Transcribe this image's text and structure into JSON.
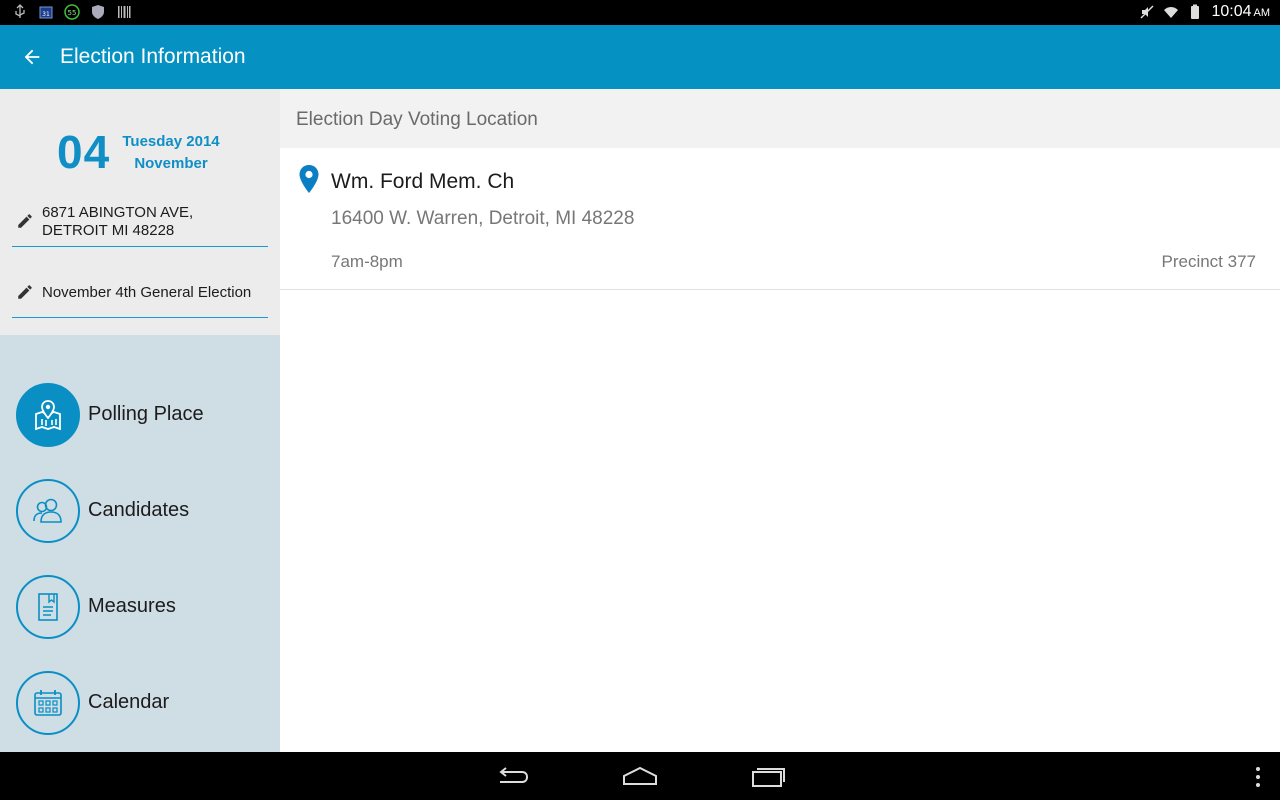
{
  "status_bar": {
    "time": "10:04",
    "ampm": "AM",
    "notification_icons": [
      "usb-icon",
      "calendar-icon",
      "badge-55-icon",
      "shield-icon",
      "barcode-icon"
    ],
    "badge_text": "55",
    "status_icons": [
      "mute-icon",
      "wifi-icon",
      "battery-icon"
    ]
  },
  "app_bar": {
    "title": "Election Information",
    "back_icon": "arrow-left-icon"
  },
  "date": {
    "day": "04",
    "weekday_year": "Tuesday 2014",
    "month": "November"
  },
  "address": {
    "line1": "6871 ABINGTON AVE,",
    "line2": "DETROIT MI 48228"
  },
  "election": {
    "name": "November 4th General Election"
  },
  "nav": {
    "items": [
      {
        "label": "Polling Place",
        "icon": "map-pin-icon",
        "active": true
      },
      {
        "label": "Candidates",
        "icon": "people-icon",
        "active": false
      },
      {
        "label": "Measures",
        "icon": "document-icon",
        "active": false
      },
      {
        "label": "Calendar",
        "icon": "calendar-icon",
        "active": false
      }
    ]
  },
  "content": {
    "section_title": "Election Day Voting Location",
    "location": {
      "name": "Wm. Ford Mem. Ch",
      "address": "16400 W. Warren, Detroit, MI 48228",
      "hours": "7am-8pm",
      "precinct": "Precinct 377"
    }
  },
  "colors": {
    "primary": "#0591c2",
    "accent": "#0a8fc4",
    "left_panel_bg": "#cfdde5",
    "left_top_bg": "#ececec",
    "header_bg": "#f2f2f2"
  },
  "system_nav": {
    "buttons": [
      "back-nav-icon",
      "home-nav-icon",
      "recents-nav-icon",
      "overflow-menu-icon"
    ]
  }
}
